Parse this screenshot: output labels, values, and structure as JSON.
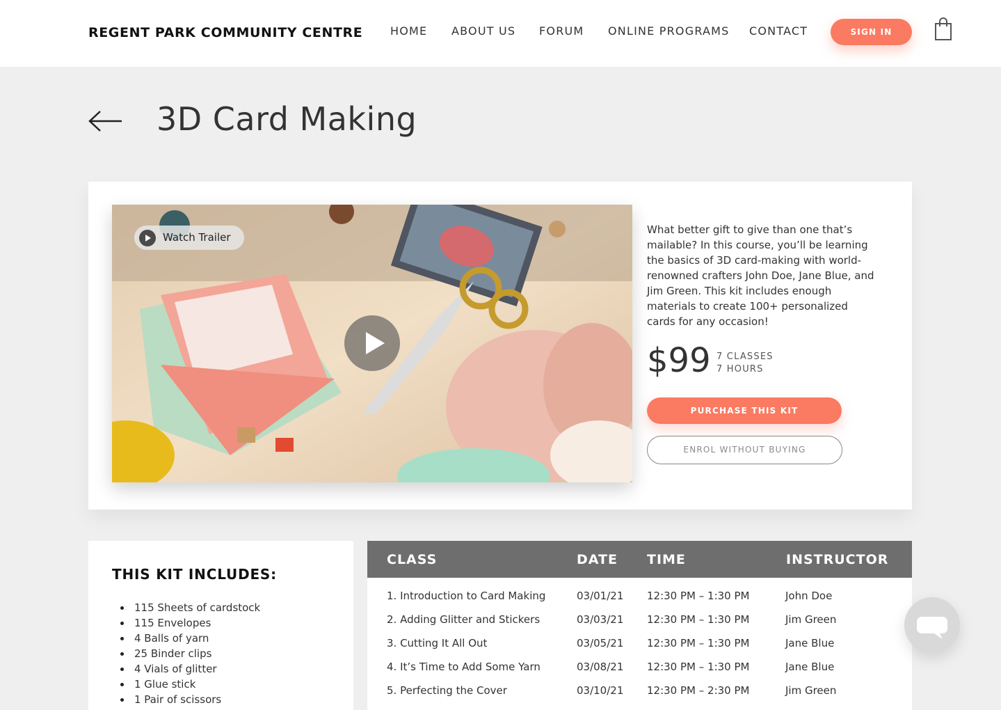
{
  "header": {
    "brand": "REGENT PARK COMMUNITY CENTRE",
    "nav": [
      "HOME",
      "ABOUT US",
      "FORUM",
      "ONLINE PROGRAMS",
      "CONTACT"
    ],
    "sign_in": "SIGN IN",
    "cart_icon": "shopping-bag-icon"
  },
  "page": {
    "back_icon": "arrow-left-icon",
    "title": "3D Card Making"
  },
  "course": {
    "trailer_label": "Watch Trailer",
    "description": "What better gift to give than one that’s mailable? In this course, you’ll be learning the basics of 3D card-making with world-renowned crafters John Doe, Jane Blue, and Jim Green. This kit includes enough materials to create 100+ personalized cards for any occasion!",
    "price": "$99",
    "classes": "7 CLASSES",
    "hours": "7 HOURS",
    "purchase_label": "PURCHASE THIS KIT",
    "enrol_label": "ENROL WITHOUT BUYING"
  },
  "kit": {
    "title": "THIS KIT INCLUDES:",
    "items": [
      "115 Sheets of cardstock",
      "115 Envelopes",
      "4 Balls of yarn",
      "25 Binder clips",
      "4 Vials of glitter",
      "1 Glue stick",
      "1 Pair of scissors"
    ]
  },
  "schedule": {
    "headers": [
      "CLASS",
      "DATE",
      "TIME",
      "INSTRUCTOR"
    ],
    "rows": [
      [
        "1. Introduction to Card Making",
        "03/01/21",
        "12:30 PM – 1:30 PM",
        "John Doe"
      ],
      [
        "2. Adding Glitter and Stickers",
        "03/03/21",
        "12:30 PM – 1:30 PM",
        "Jim Green"
      ],
      [
        "3. Cutting It All Out",
        "03/05/21",
        "12:30 PM – 1:30 PM",
        "Jane Blue"
      ],
      [
        "4. It’s Time to Add Some Yarn",
        "03/08/21",
        "12:30 PM – 1:30 PM",
        "Jane Blue"
      ],
      [
        "5. Perfecting the Cover",
        "03/10/21",
        "12:30 PM – 2:30 PM",
        "Jim Green"
      ]
    ]
  },
  "colors": {
    "accent": "#fb7a62",
    "table_header": "#6e6e6e",
    "background": "#efefef"
  }
}
